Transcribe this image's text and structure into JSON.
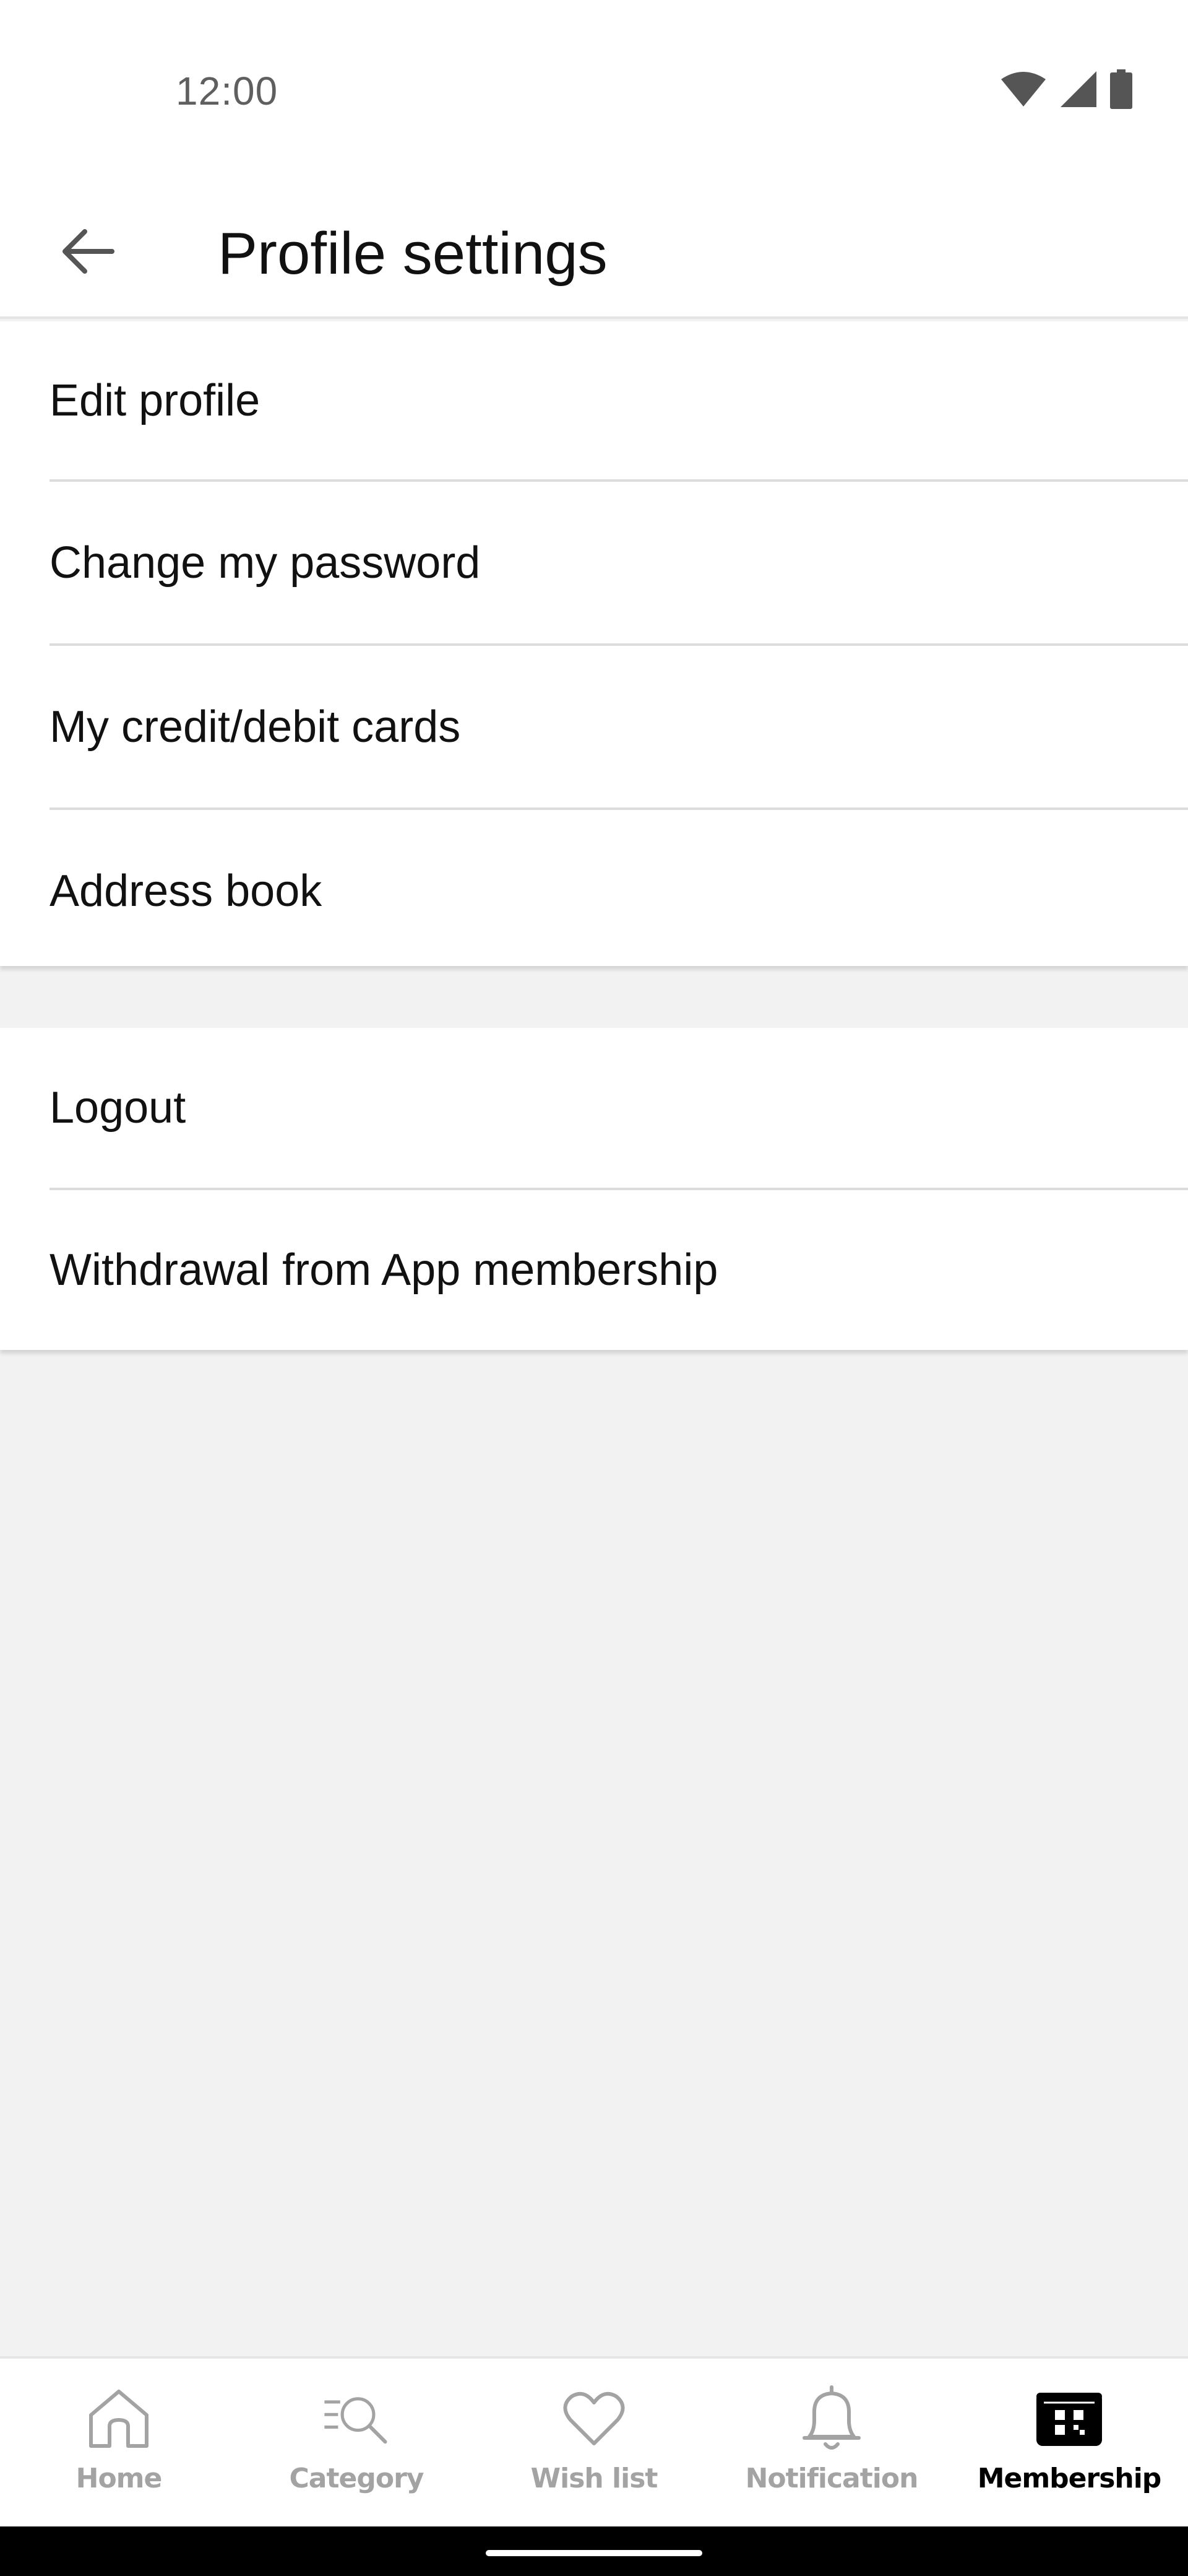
{
  "status_bar": {
    "time": "12:00"
  },
  "header": {
    "title": "Profile settings",
    "back_icon": "arrow-back-icon"
  },
  "settings_group_1": {
    "items": [
      {
        "label": "Edit profile"
      },
      {
        "label": "Change my password"
      },
      {
        "label": "My credit/debit cards"
      },
      {
        "label": "Address book"
      }
    ]
  },
  "settings_group_2": {
    "items": [
      {
        "label": "Logout"
      },
      {
        "label": "Withdrawal from App membership"
      }
    ]
  },
  "bottom_nav": {
    "items": [
      {
        "label": "Home",
        "icon": "home-icon",
        "active": false
      },
      {
        "label": "Category",
        "icon": "category-search-icon",
        "active": false
      },
      {
        "label": "Wish list",
        "icon": "heart-icon",
        "active": false
      },
      {
        "label": "Notification",
        "icon": "bell-icon",
        "active": false
      },
      {
        "label": "Membership",
        "icon": "membership-card-icon",
        "active": true
      }
    ]
  },
  "colors": {
    "background": "#f2f2f2",
    "surface": "#ffffff",
    "text_primary": "#111111",
    "nav_inactive": "#a3a3a3",
    "nav_active": "#000000",
    "divider": "#dcdcdc"
  }
}
